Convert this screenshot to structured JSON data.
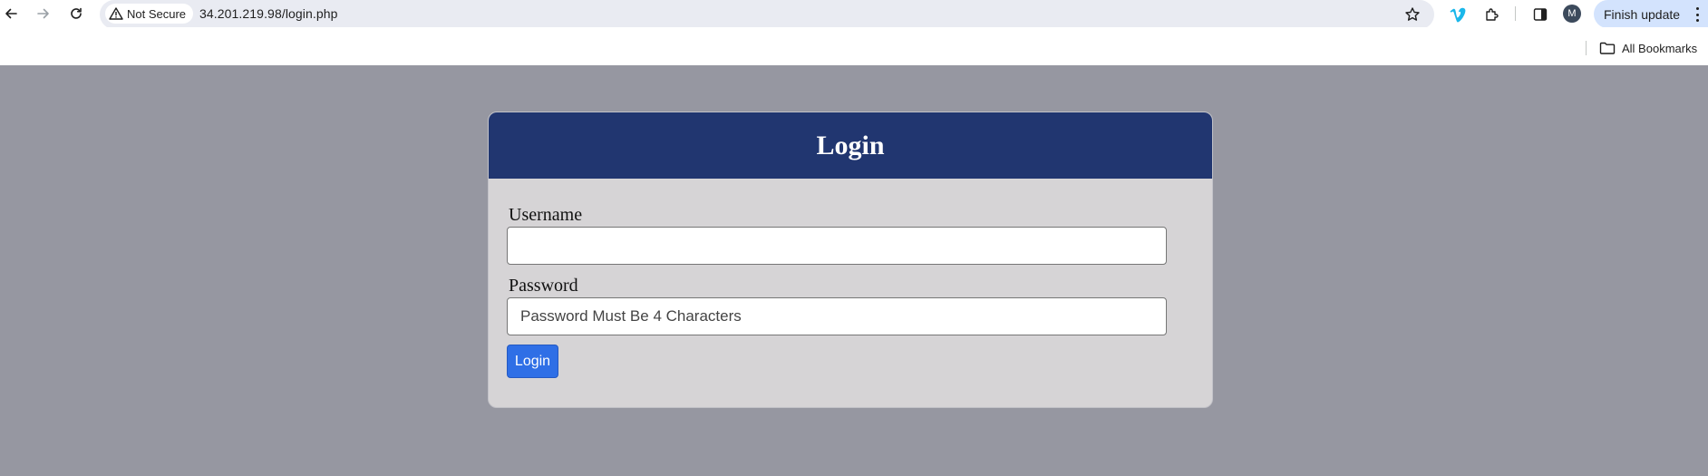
{
  "browser": {
    "security_label": "Not Secure",
    "url": "34.201.219.98/login.php",
    "avatar_initial": "M",
    "update_label": "Finish update",
    "bookmarks_label": "All Bookmarks",
    "icons": [
      "back-arrow-icon",
      "forward-arrow-icon",
      "reload-icon",
      "warning-triangle-icon",
      "star-icon",
      "vimeo-icon",
      "puzzle-icon",
      "side-panel-icon",
      "kebab-menu-icon",
      "folder-icon"
    ]
  },
  "page": {
    "title": "Login",
    "username_label": "Username",
    "username_value": "",
    "password_label": "Password",
    "password_placeholder": "Password Must Be 4 Characters",
    "submit_label": "Login"
  },
  "colors": {
    "page_background": "#9697a1",
    "card_background": "#d6d4d6",
    "header_background": "#213670",
    "button_background": "#2f6fe6",
    "update_chip": "#d3e3fd",
    "vimeo_blue": "#1ab7ea"
  }
}
